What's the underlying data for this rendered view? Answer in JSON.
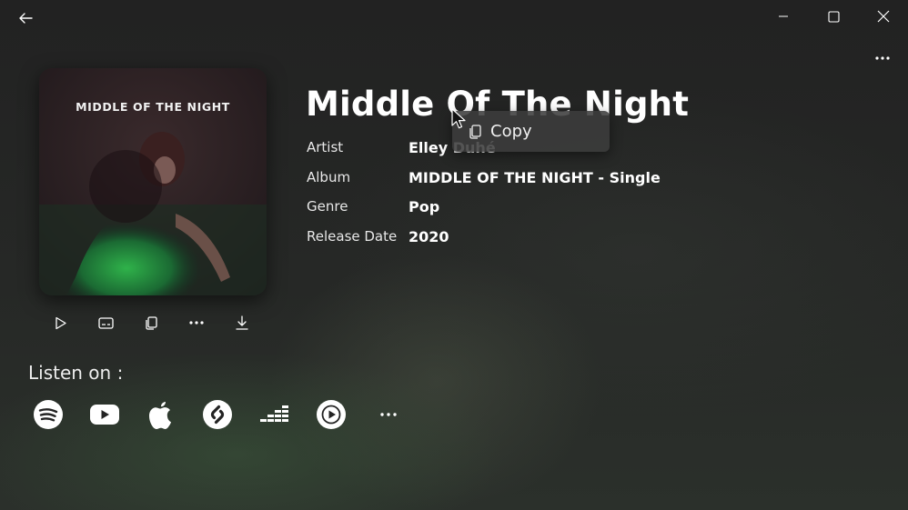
{
  "song": {
    "title": "Middle Of The Night",
    "cover_text": "MIDDLE OF THE NIGHT"
  },
  "metadata": [
    {
      "key": "Artist",
      "value": "Elley Duhé"
    },
    {
      "key": "Album",
      "value": "MIDDLE OF THE NIGHT - Single"
    },
    {
      "key": "Genre",
      "value": "Pop"
    },
    {
      "key": "Release Date",
      "value": "2020"
    }
  ],
  "context_menu": {
    "copy_label": "Copy"
  },
  "actions": [
    {
      "name": "play-button",
      "icon": "play-icon"
    },
    {
      "name": "lyrics-button",
      "icon": "subtitles-icon"
    },
    {
      "name": "copy-button",
      "icon": "copy-icon"
    },
    {
      "name": "more-actions-button",
      "icon": "more-icon"
    },
    {
      "name": "download-button",
      "icon": "download-icon"
    }
  ],
  "listen": {
    "label": "Listen on :",
    "services": [
      {
        "name": "spotify",
        "icon": "spotify-icon"
      },
      {
        "name": "youtube",
        "icon": "youtube-icon"
      },
      {
        "name": "apple-music",
        "icon": "apple-icon"
      },
      {
        "name": "shazam",
        "icon": "shazam-icon"
      },
      {
        "name": "deezer",
        "icon": "deezer-icon"
      },
      {
        "name": "youtube-music",
        "icon": "youtube-music-icon"
      },
      {
        "name": "more",
        "icon": "more-icon"
      }
    ]
  },
  "colors": {
    "background": "#232323",
    "text": "#ffffff"
  }
}
